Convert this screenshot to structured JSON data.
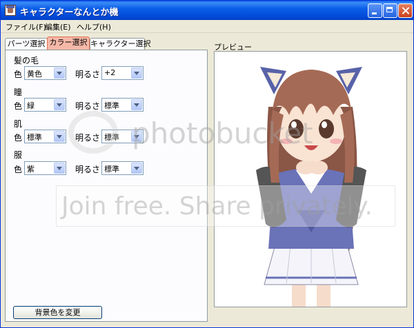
{
  "window": {
    "title": "キャラクターなんとか機"
  },
  "menu": [
    {
      "label": "ファイル(F)"
    },
    {
      "label": "編集(E)"
    },
    {
      "label": "ヘルプ(H)"
    }
  ],
  "tabs": [
    {
      "label": "パーツ選択"
    },
    {
      "label": "カラー選択"
    },
    {
      "label": "キャラクター選択"
    }
  ],
  "active_tab": "カラー選択",
  "sections": [
    {
      "title": "髪の毛",
      "color_label": "色",
      "color_value": "黄色",
      "brightness_label": "明るさ",
      "brightness_value": "+2"
    },
    {
      "title": "瞳",
      "color_label": "色",
      "color_value": "緑",
      "brightness_label": "明るさ",
      "brightness_value": "標準"
    },
    {
      "title": "肌",
      "color_label": "色",
      "color_value": "標準",
      "brightness_label": "明るさ",
      "brightness_value": "標準"
    },
    {
      "title": "服",
      "color_label": "色",
      "color_value": "紫",
      "brightness_label": "明るさ",
      "brightness_value": "標準"
    }
  ],
  "background_button": "背景色を変更",
  "preview_label": "プレビュー",
  "watermark": {
    "line1": "photobucket",
    "line2": "Join free. Share privately."
  },
  "colors": {
    "titlebar": "#0054e3",
    "window_bg": "#ece9d8",
    "active_tab": "#f5b8a8",
    "hair": "#a56a55",
    "ears": "#5862a8",
    "shirt": "#6a72b8",
    "sleeves": "#555555",
    "skirt": "#f4f4fa"
  }
}
